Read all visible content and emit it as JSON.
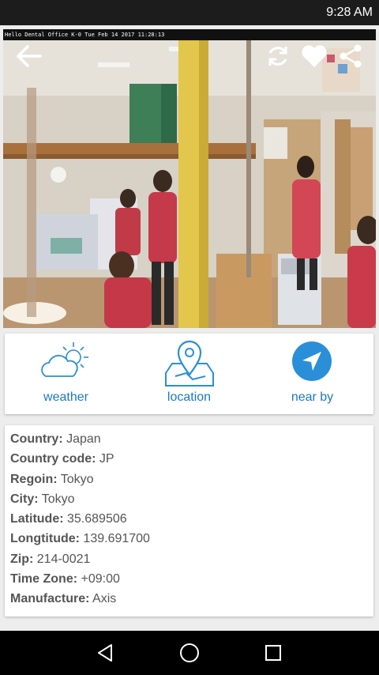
{
  "status_bar": {
    "time": "9:28 AM"
  },
  "camera": {
    "overlay_text": "Hello Dental Office K-0 Tue Feb 14 2017 11:28:13",
    "icons": {
      "back": "arrow-left-icon",
      "refresh": "refresh-icon",
      "favorite": "heart-icon",
      "share": "share-icon"
    }
  },
  "actions": {
    "weather_label": "weather",
    "location_label": "location",
    "nearby_label": "near by"
  },
  "info": [
    {
      "key": "Country:",
      "value": "Japan"
    },
    {
      "key": "Country code:",
      "value": "JP"
    },
    {
      "key": "Regoin:",
      "value": "Tokyo"
    },
    {
      "key": "City:",
      "value": "Tokyo"
    },
    {
      "key": "Latitude:",
      "value": "35.689506"
    },
    {
      "key": "Longtitude:",
      "value": "139.691700"
    },
    {
      "key": "Zip:",
      "value": "214-0021"
    },
    {
      "key": "Time Zone:",
      "value": "+09:00"
    },
    {
      "key": "Manufacture:",
      "value": "Axis"
    }
  ],
  "colors": {
    "accent": "#1a78c8",
    "icon_blue": "#2a8fd8"
  }
}
